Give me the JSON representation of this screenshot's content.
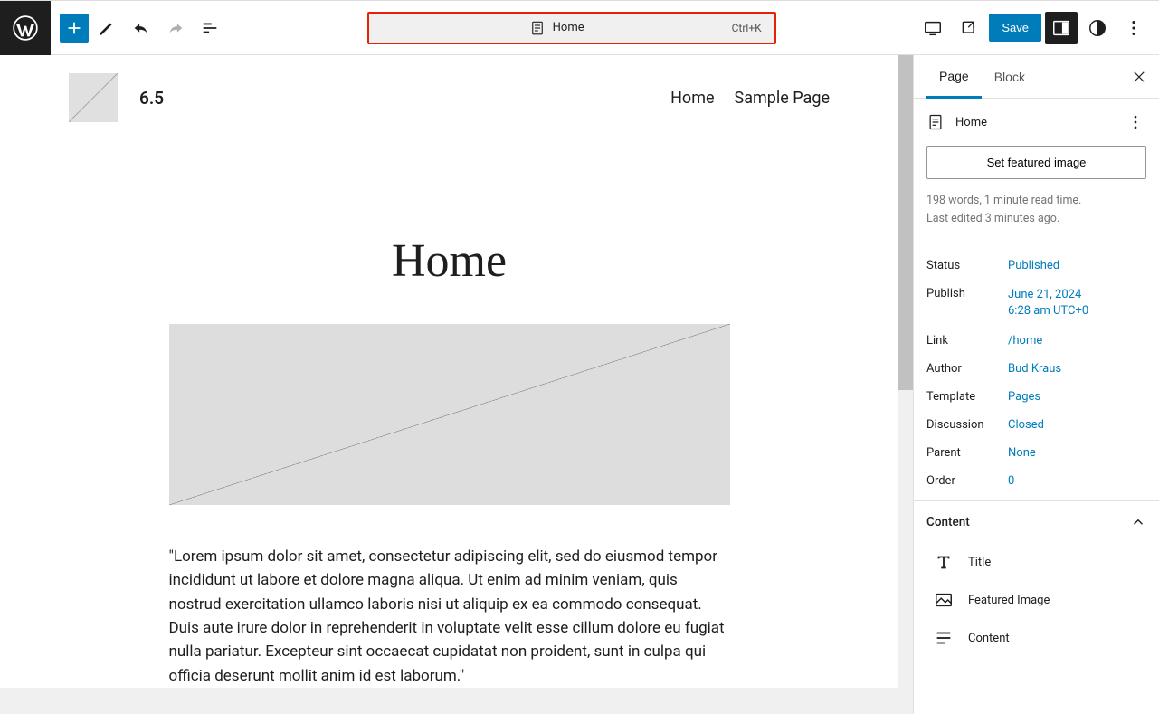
{
  "toolbar": {
    "cmd_title": "Home",
    "cmd_shortcut": "Ctrl+K",
    "save_label": "Save"
  },
  "canvas": {
    "site_title": "6.5",
    "nav": [
      "Home",
      "Sample Page"
    ],
    "page_title": "Home",
    "paragraph": "\"Lorem ipsum dolor sit amet, consectetur adipiscing elit, sed do eiusmod tempor incididunt ut labore et dolore magna aliqua. Ut enim ad minim veniam, quis nostrud exercitation ullamco laboris nisi ut aliquip ex ea commodo consequat. Duis aute irure dolor in reprehenderit in voluptate velit esse cillum dolore eu fugiat nulla pariatur. Excepteur sint occaecat cupidatat non proident, sunt in culpa qui officia deserunt mollit anim id est laborum.\""
  },
  "sidebar": {
    "tabs": {
      "page": "Page",
      "block": "Block"
    },
    "doc_title": "Home",
    "featured_btn": "Set featured image",
    "meta_line1": "198 words, 1 minute read time.",
    "meta_line2": "Last edited 3 minutes ago.",
    "rows": {
      "status_k": "Status",
      "status_v": "Published",
      "publish_k": "Publish",
      "publish_v1": "June 21, 2024",
      "publish_v2": "6:28 am UTC+0",
      "link_k": "Link",
      "link_v": "/home",
      "author_k": "Author",
      "author_v": "Bud Kraus",
      "template_k": "Template",
      "template_v": "Pages",
      "discussion_k": "Discussion",
      "discussion_v": "Closed",
      "parent_k": "Parent",
      "parent_v": "None",
      "order_k": "Order",
      "order_v": "0"
    },
    "content_header": "Content",
    "content_items": {
      "title": "Title",
      "featured": "Featured Image",
      "content": "Content"
    }
  }
}
